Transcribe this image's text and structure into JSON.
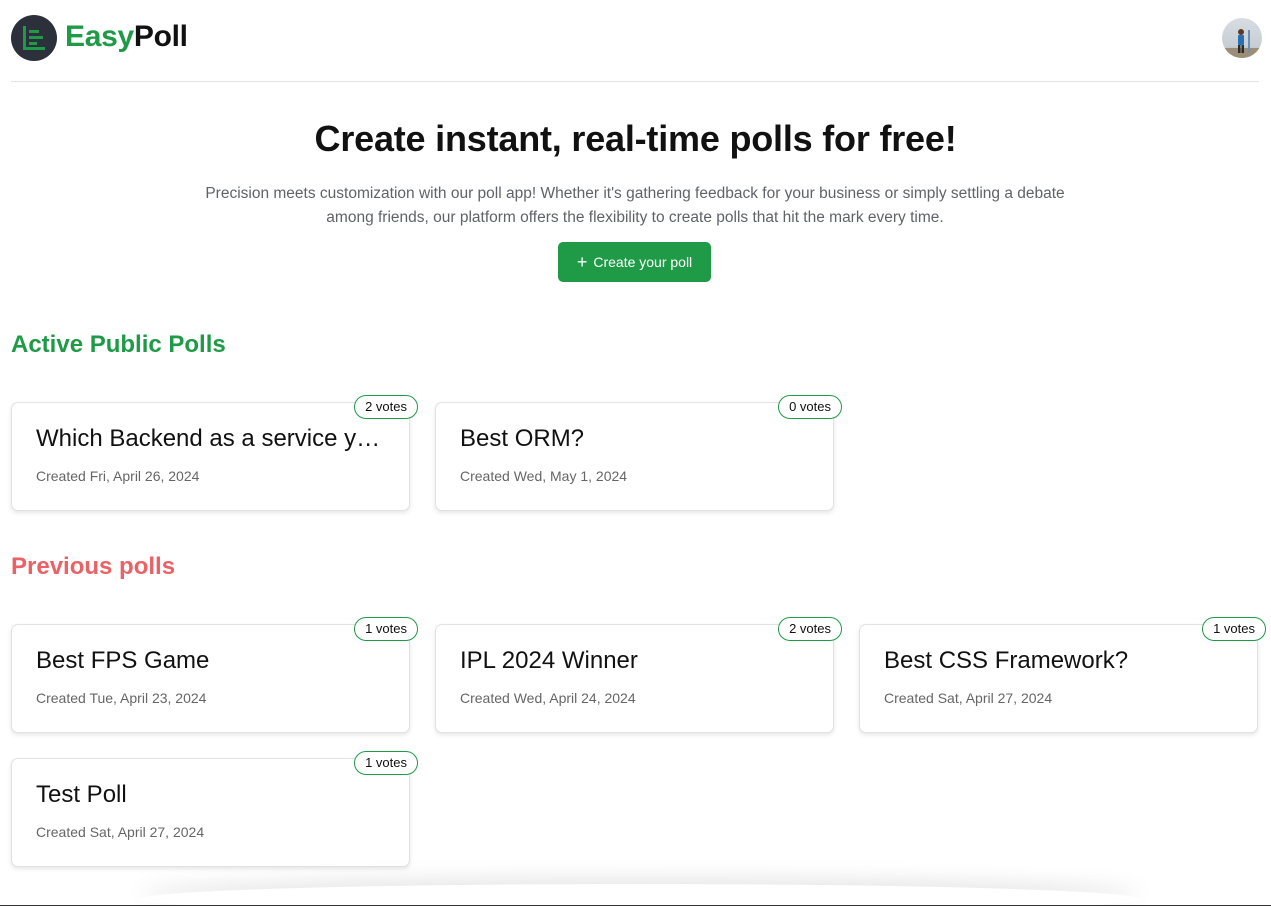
{
  "brand": {
    "part1": "Easy",
    "part2": "Poll"
  },
  "hero": {
    "title": "Create instant, real-time polls for free!",
    "description": "Precision meets customization with our poll app! Whether it's gathering feedback for your business or simply settling a debate among friends, our platform offers the flexibility to create polls that hit the mark every time.",
    "cta_icon": "+",
    "cta_label": "Create your poll"
  },
  "active": {
    "title": "Active Public Polls",
    "polls": [
      {
        "question": "Which Backend as a service you...",
        "created": "Created Fri, April 26, 2024",
        "votes": "2 votes"
      },
      {
        "question": "Best ORM?",
        "created": "Created Wed, May 1, 2024",
        "votes": "0 votes"
      }
    ]
  },
  "previous": {
    "title": "Previous polls",
    "polls": [
      {
        "question": "Best FPS Game",
        "created": "Created Tue, April 23, 2024",
        "votes": "1 votes"
      },
      {
        "question": "IPL 2024 Winner",
        "created": "Created Wed, April 24, 2024",
        "votes": "2 votes"
      },
      {
        "question": "Best CSS Framework?",
        "created": "Created Sat, April 27, 2024",
        "votes": "1 votes"
      },
      {
        "question": "Test Poll",
        "created": "Created Sat, April 27, 2024",
        "votes": "1 votes"
      }
    ]
  },
  "icons": {
    "logo": "bar-chart-icon",
    "avatar": "user-avatar",
    "cta": "plus-icon"
  },
  "colors": {
    "primary": "#1f9a47",
    "previous_accent": "#ea6166",
    "logo_bg": "#2b303b"
  }
}
